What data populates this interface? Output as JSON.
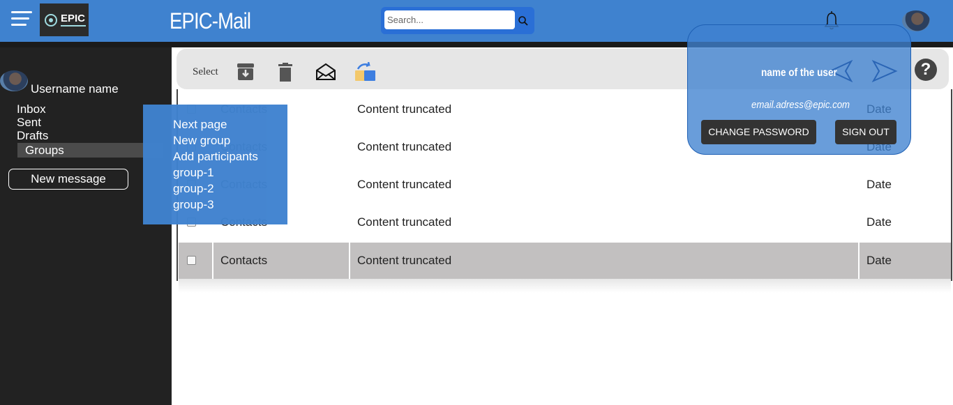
{
  "header": {
    "logo_text": "EPIC",
    "title": "EPIC-Mail",
    "search_placeholder": "Search..."
  },
  "sidebar": {
    "username": "Username name",
    "items": [
      {
        "label": "Inbox"
      },
      {
        "label": "Sent"
      },
      {
        "label": "Drafts"
      },
      {
        "label": "Groups"
      }
    ],
    "new_message_label": "New message"
  },
  "groups_menu": {
    "items": [
      {
        "label": "Next page"
      },
      {
        "label": "New group"
      },
      {
        "label": "Add participants"
      },
      {
        "label": "group-1"
      },
      {
        "label": "group-2"
      },
      {
        "label": "group-3"
      }
    ]
  },
  "toolbar": {
    "select_label": "Select",
    "help_label": "?"
  },
  "messages": {
    "rows": [
      {
        "from": "Contacts",
        "content": "Content truncated",
        "date": "Date"
      },
      {
        "from": "Contacts",
        "content": "Content truncated",
        "date": "Date"
      },
      {
        "from": "Contacts",
        "content": "Content truncated",
        "date": "Date"
      },
      {
        "from": "Contacts",
        "content": "Content truncated",
        "date": "Date"
      },
      {
        "from": "Contacts",
        "content": "Content truncated",
        "date": "Date"
      }
    ]
  },
  "profile": {
    "name": "name of the user",
    "email": "email.adress@epic.com",
    "change_password_label": "CHANGE PASSWORD",
    "sign_out_label": "SIGN OUT"
  },
  "colors": {
    "header_blue": "#3f82cf",
    "sidebar_dark": "#222222",
    "toolbar_gray": "#e6e6e6",
    "selected_row": "#c2c0c0"
  }
}
